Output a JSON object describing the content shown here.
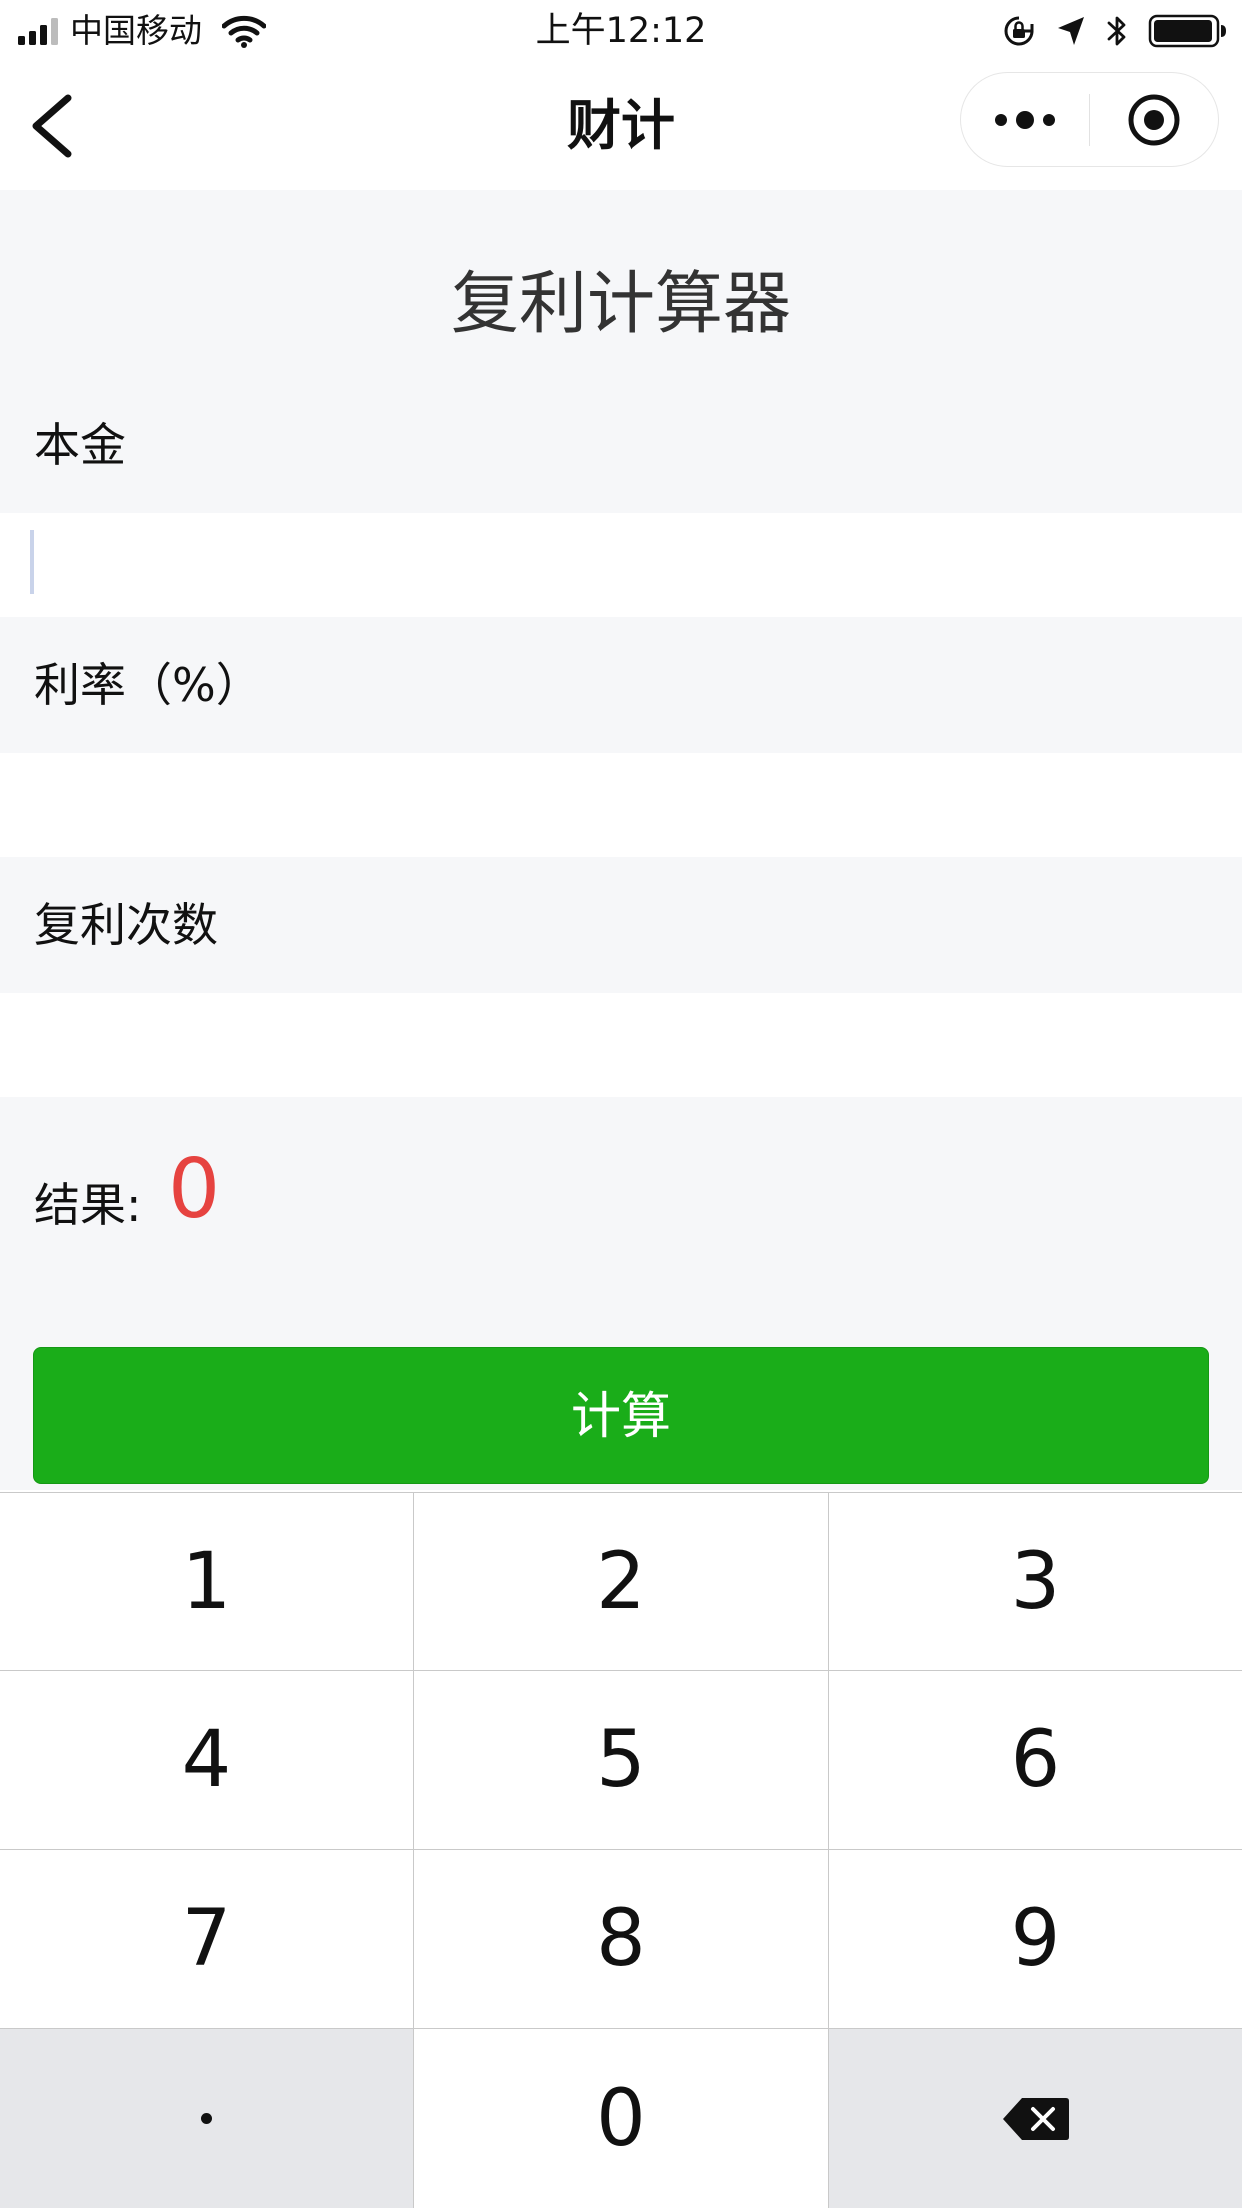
{
  "status_bar": {
    "carrier": "中国移动",
    "time": "上午12:12",
    "icons": [
      "signal-icon",
      "wifi-icon",
      "orientation-lock-icon",
      "location-icon",
      "bluetooth-icon",
      "battery-icon"
    ]
  },
  "nav": {
    "title": "财计",
    "icons": [
      "back-chevron-icon",
      "more-dots-icon",
      "close-target-icon"
    ]
  },
  "form": {
    "title": "复利计算器",
    "principal_label": "本金",
    "principal_value": "",
    "rate_label": "利率（%）",
    "rate_value": "",
    "times_label": "复利次数",
    "times_value": "",
    "result_label": "结果:",
    "result_value": "0",
    "calculate_label": "计算"
  },
  "keypad": {
    "keys": [
      "1",
      "2",
      "3",
      "4",
      "5",
      "6",
      "7",
      "8",
      "9",
      "·",
      "0",
      "⌫"
    ]
  },
  "colors": {
    "accent_green": "#1aad19",
    "result_red": "#e64340",
    "content_bg": "#f6f7f9",
    "keypad_dark_key": "#e6e7ea"
  }
}
